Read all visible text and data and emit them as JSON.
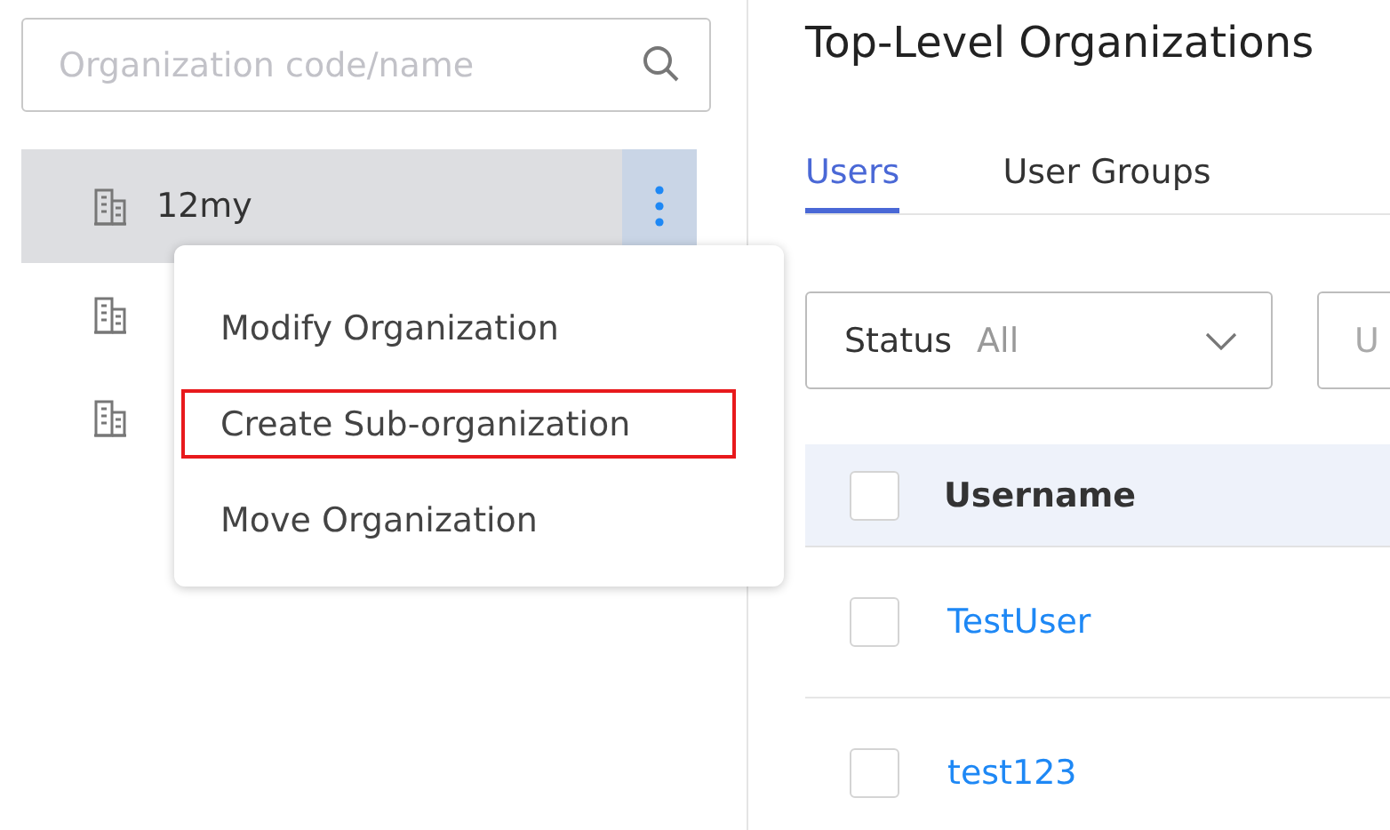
{
  "sidebar": {
    "search": {
      "placeholder": "Organization code/name"
    },
    "tree": [
      {
        "name": "12my",
        "selected": true,
        "menu_open": true
      },
      {
        "selected": false,
        "menu_open": false
      },
      {
        "selected": false,
        "menu_open": false
      }
    ],
    "context_menu": [
      {
        "label": "Modify Organization",
        "highlighted": false
      },
      {
        "label": "Create Sub-organization",
        "highlighted": true
      },
      {
        "label": "Move Organization",
        "highlighted": false
      }
    ]
  },
  "main": {
    "title": "Top-Level Organizations",
    "tabs": [
      {
        "label": "Users",
        "selected": true
      },
      {
        "label": "User Groups",
        "selected": false
      }
    ],
    "filters": [
      {
        "label": "Status",
        "value": "All",
        "kind": "select"
      },
      {
        "placeholder": "U",
        "kind": "input"
      }
    ],
    "table": {
      "all_checked": false,
      "columns": [
        "Username"
      ],
      "rows": [
        {
          "username": "TestUser",
          "checked": false
        },
        {
          "username": "test123",
          "checked": false
        }
      ]
    }
  }
}
